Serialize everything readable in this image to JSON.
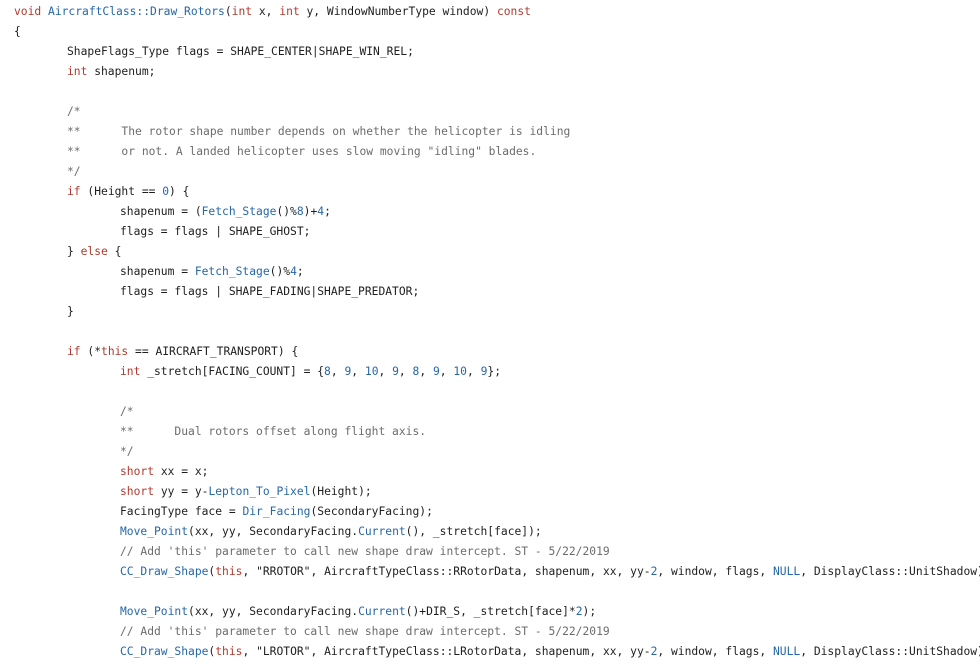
{
  "colors": {
    "background": "#ffffff",
    "keyword": "#b03a2e",
    "function": "#2667a8",
    "number": "#2667a8",
    "text": "#1e1e1e",
    "comment": "#6c6c6c"
  },
  "lines": [
    {
      "indent": 0,
      "tokens": [
        [
          "kw",
          "void "
        ],
        [
          "fn",
          "AircraftClass::Draw_Rotors"
        ],
        [
          "tx",
          "("
        ],
        [
          "kw",
          "int"
        ],
        [
          "tx",
          " x, "
        ],
        [
          "kw",
          "int"
        ],
        [
          "tx",
          " y, WindowNumberType window) "
        ],
        [
          "kw",
          "const"
        ]
      ]
    },
    {
      "indent": 0,
      "tokens": [
        [
          "tx",
          "{"
        ]
      ]
    },
    {
      "indent": 1,
      "tokens": [
        [
          "tx",
          "ShapeFlags_Type flags = SHAPE_CENTER|SHAPE_WIN_REL;"
        ]
      ]
    },
    {
      "indent": 1,
      "tokens": [
        [
          "kw",
          "int"
        ],
        [
          "tx",
          " shapenum;"
        ]
      ]
    },
    {
      "indent": 1,
      "tokens": []
    },
    {
      "indent": 1,
      "tokens": [
        [
          "cm",
          "/*"
        ]
      ]
    },
    {
      "indent": 1,
      "tokens": [
        [
          "cm",
          "**      The rotor shape number depends on whether the helicopter is idling"
        ]
      ]
    },
    {
      "indent": 1,
      "tokens": [
        [
          "cm",
          "**      or not. A landed helicopter uses slow moving \"idling\" blades."
        ]
      ]
    },
    {
      "indent": 1,
      "tokens": [
        [
          "cm",
          "*/"
        ]
      ]
    },
    {
      "indent": 1,
      "tokens": [
        [
          "kw",
          "if"
        ],
        [
          "tx",
          " (Height == "
        ],
        [
          "num",
          "0"
        ],
        [
          "tx",
          ") {"
        ]
      ]
    },
    {
      "indent": 2,
      "tokens": [
        [
          "tx",
          "shapenum = ("
        ],
        [
          "fn",
          "Fetch_Stage"
        ],
        [
          "tx",
          "()%"
        ],
        [
          "num",
          "8"
        ],
        [
          "tx",
          ")+"
        ],
        [
          "num",
          "4"
        ],
        [
          "tx",
          ";"
        ]
      ]
    },
    {
      "indent": 2,
      "tokens": [
        [
          "tx",
          "flags = flags | SHAPE_GHOST;"
        ]
      ]
    },
    {
      "indent": 1,
      "tokens": [
        [
          "tx",
          "} "
        ],
        [
          "kw",
          "else"
        ],
        [
          "tx",
          " {"
        ]
      ]
    },
    {
      "indent": 2,
      "tokens": [
        [
          "tx",
          "shapenum = "
        ],
        [
          "fn",
          "Fetch_Stage"
        ],
        [
          "tx",
          "()%"
        ],
        [
          "num",
          "4"
        ],
        [
          "tx",
          ";"
        ]
      ]
    },
    {
      "indent": 2,
      "tokens": [
        [
          "tx",
          "flags = flags | SHAPE_FADING|SHAPE_PREDATOR;"
        ]
      ]
    },
    {
      "indent": 1,
      "tokens": [
        [
          "tx",
          "}"
        ]
      ]
    },
    {
      "indent": 1,
      "tokens": []
    },
    {
      "indent": 1,
      "tokens": [
        [
          "kw",
          "if"
        ],
        [
          "tx",
          " (*"
        ],
        [
          "kw",
          "this"
        ],
        [
          "tx",
          " == AIRCRAFT_TRANSPORT) {"
        ]
      ]
    },
    {
      "indent": 2,
      "tokens": [
        [
          "kw",
          "int"
        ],
        [
          "tx",
          " _stretch[FACING_COUNT] = {"
        ],
        [
          "num",
          "8"
        ],
        [
          "tx",
          ", "
        ],
        [
          "num",
          "9"
        ],
        [
          "tx",
          ", "
        ],
        [
          "num",
          "10"
        ],
        [
          "tx",
          ", "
        ],
        [
          "num",
          "9"
        ],
        [
          "tx",
          ", "
        ],
        [
          "num",
          "8"
        ],
        [
          "tx",
          ", "
        ],
        [
          "num",
          "9"
        ],
        [
          "tx",
          ", "
        ],
        [
          "num",
          "10"
        ],
        [
          "tx",
          ", "
        ],
        [
          "num",
          "9"
        ],
        [
          "tx",
          "};"
        ]
      ]
    },
    {
      "indent": 2,
      "tokens": []
    },
    {
      "indent": 2,
      "tokens": [
        [
          "cm",
          "/*"
        ]
      ]
    },
    {
      "indent": 2,
      "tokens": [
        [
          "cm",
          "**      Dual rotors offset along flight axis."
        ]
      ]
    },
    {
      "indent": 2,
      "tokens": [
        [
          "cm",
          "*/"
        ]
      ]
    },
    {
      "indent": 2,
      "tokens": [
        [
          "kw",
          "short"
        ],
        [
          "tx",
          " xx = x;"
        ]
      ]
    },
    {
      "indent": 2,
      "tokens": [
        [
          "kw",
          "short"
        ],
        [
          "tx",
          " yy = y-"
        ],
        [
          "fn",
          "Lepton_To_Pixel"
        ],
        [
          "tx",
          "(Height);"
        ]
      ]
    },
    {
      "indent": 2,
      "tokens": [
        [
          "tx",
          "FacingType face = "
        ],
        [
          "fn",
          "Dir_Facing"
        ],
        [
          "tx",
          "(SecondaryFacing);"
        ]
      ]
    },
    {
      "indent": 2,
      "tokens": [
        [
          "fn",
          "Move_Point"
        ],
        [
          "tx",
          "(xx, yy, SecondaryFacing."
        ],
        [
          "fn",
          "Current"
        ],
        [
          "tx",
          "(), _stretch[face]);"
        ]
      ]
    },
    {
      "indent": 2,
      "tokens": [
        [
          "cm",
          "// Add 'this' parameter to call new shape draw intercept. ST - 5/22/2019"
        ]
      ]
    },
    {
      "indent": 2,
      "tokens": [
        [
          "fn",
          "CC_Draw_Shape"
        ],
        [
          "tx",
          "("
        ],
        [
          "kw",
          "this"
        ],
        [
          "tx",
          ", "
        ],
        [
          "str",
          "\"RROTOR\""
        ],
        [
          "tx",
          ", AircraftTypeClass::RRotorData, shapenum, xx, yy-"
        ],
        [
          "num",
          "2"
        ],
        [
          "tx",
          ", window, flags, "
        ],
        [
          "fn",
          "NULL"
        ],
        [
          "tx",
          ", DisplayClass::UnitShadow);"
        ]
      ]
    },
    {
      "indent": 2,
      "tokens": []
    },
    {
      "indent": 2,
      "tokens": [
        [
          "fn",
          "Move_Point"
        ],
        [
          "tx",
          "(xx, yy, SecondaryFacing."
        ],
        [
          "fn",
          "Current"
        ],
        [
          "tx",
          "()+DIR_S, _stretch[face]*"
        ],
        [
          "num",
          "2"
        ],
        [
          "tx",
          ");"
        ]
      ]
    },
    {
      "indent": 2,
      "tokens": [
        [
          "cm",
          "// Add 'this' parameter to call new shape draw intercept. ST - 5/22/2019"
        ]
      ]
    },
    {
      "indent": 2,
      "tokens": [
        [
          "fn",
          "CC_Draw_Shape"
        ],
        [
          "tx",
          "("
        ],
        [
          "kw",
          "this"
        ],
        [
          "tx",
          ", "
        ],
        [
          "str",
          "\"LROTOR\""
        ],
        [
          "tx",
          ", AircraftTypeClass::LRotorData, shapenum, xx, yy-"
        ],
        [
          "num",
          "2"
        ],
        [
          "tx",
          ", window, flags, "
        ],
        [
          "fn",
          "NULL"
        ],
        [
          "tx",
          ", DisplayClass::UnitShadow);"
        ]
      ]
    }
  ]
}
